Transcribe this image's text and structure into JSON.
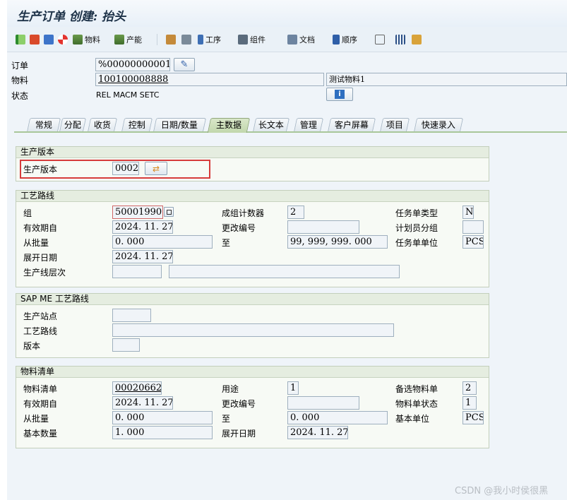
{
  "title": "生产订单 创建: 抬头",
  "toolbar": {
    "material": "物料",
    "capacity": "产能",
    "operation": "工序",
    "component": "组件",
    "document": "文档",
    "sequence": "顺序"
  },
  "header": {
    "order_label": "订单",
    "order_value": "%00000000001",
    "material_label": "物料",
    "material_value": "100100008888",
    "material_desc": "测试物料1",
    "status_label": "状态",
    "status_value": "REL  MACM SETC"
  },
  "tabs": [
    {
      "label": "常规"
    },
    {
      "label": "分配"
    },
    {
      "label": "收货"
    },
    {
      "label": "控制"
    },
    {
      "label": "日期/数量"
    },
    {
      "label": "主数据",
      "active": true
    },
    {
      "label": "长文本"
    },
    {
      "label": "管理"
    },
    {
      "label": "客户屏幕"
    },
    {
      "label": "项目"
    },
    {
      "label": "快速录入"
    }
  ],
  "prod_version": {
    "header": "生产版本",
    "label": "生产版本",
    "value": "0002"
  },
  "routing": {
    "header": "工艺路线",
    "group_label": "组",
    "group_value": "50001990",
    "counter_label": "成组计数器",
    "counter_value": "2",
    "order_type_label": "任务单类型",
    "order_type_value": "N",
    "valid_from_label": "有效期自",
    "valid_from_value": "2024. 11. 27",
    "change_no_label": "更改编号",
    "change_no_value": "",
    "planner_group_label": "计划员分组",
    "planner_group_value": "",
    "from_lot_label": "从批量",
    "from_lot_value": "0. 000",
    "to_label": "至",
    "to_value": "99, 999, 999. 000",
    "unit_label": "任务单单位",
    "unit_value": "PCS",
    "explosion_label": "展开日期",
    "explosion_value": "2024. 11. 27",
    "line_level_label": "生产线层次",
    "line_level_value": "",
    "line_level_desc": ""
  },
  "sapme": {
    "header": "SAP ME 工艺路线",
    "station_label": "生产站点",
    "station_value": "",
    "routing_label": "工艺路线",
    "routing_value": "",
    "version_label": "版本",
    "version_value": ""
  },
  "bom": {
    "header": "物料清单",
    "bom_label": "物料清单",
    "bom_value": "00020662",
    "usage_label": "用途",
    "usage_value": "1",
    "alt_label": "备选物料单",
    "alt_value": "2",
    "valid_from_label": "有效期自",
    "valid_from_value": "2024. 11. 27",
    "change_no_label": "更改编号",
    "change_no_value": "",
    "status_label": "物料单状态",
    "status_value": "1",
    "from_lot_label": "从批量",
    "from_lot_value": "0. 000",
    "to_label": "至",
    "to_value": "0. 000",
    "unit_label": "基本单位",
    "unit_value": "PCS",
    "base_qty_label": "基本数量",
    "base_qty_value": "1. 000",
    "explosion_label": "展开日期",
    "explosion_value": "2024. 11. 27"
  },
  "watermark": "CSDN @我小时侯很黑"
}
